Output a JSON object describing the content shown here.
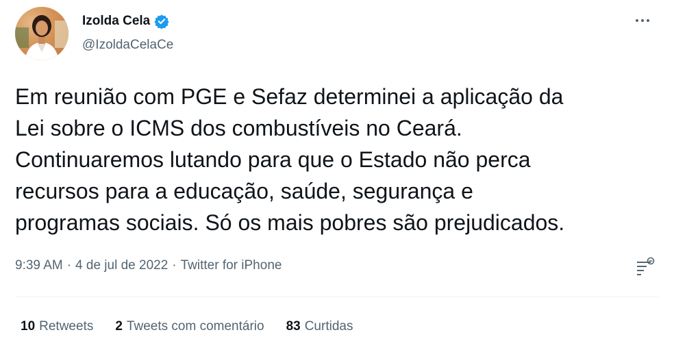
{
  "author": {
    "name": "Izolda Cela",
    "handle": "@IzoldaCelaCe",
    "verified": true,
    "verified_color": "#1d9bf0"
  },
  "tweet": {
    "lines": [
      "Em reunião com PGE e Sefaz determinei a aplicação da",
      "Lei sobre o ICMS dos combustíveis no Ceará.",
      "Continuaremos lutando para que o Estado não perca",
      "recursos para a educação, saúde, segurança e",
      "programas sociais. Só os mais pobres são prejudicados."
    ]
  },
  "meta": {
    "time": "9:39 AM",
    "separator": "·",
    "date": "4 de jul de 2022",
    "source": "Twitter for iPhone"
  },
  "stats": {
    "retweets": {
      "count": "10",
      "label": "Retweets"
    },
    "quotes": {
      "count": "2",
      "label": "Tweets com comentário"
    },
    "likes": {
      "count": "83",
      "label": "Curtidas"
    }
  },
  "icons": {
    "more": "more-options-icon",
    "analytics": "analytics-icon",
    "verified": "verified-badge-icon"
  }
}
